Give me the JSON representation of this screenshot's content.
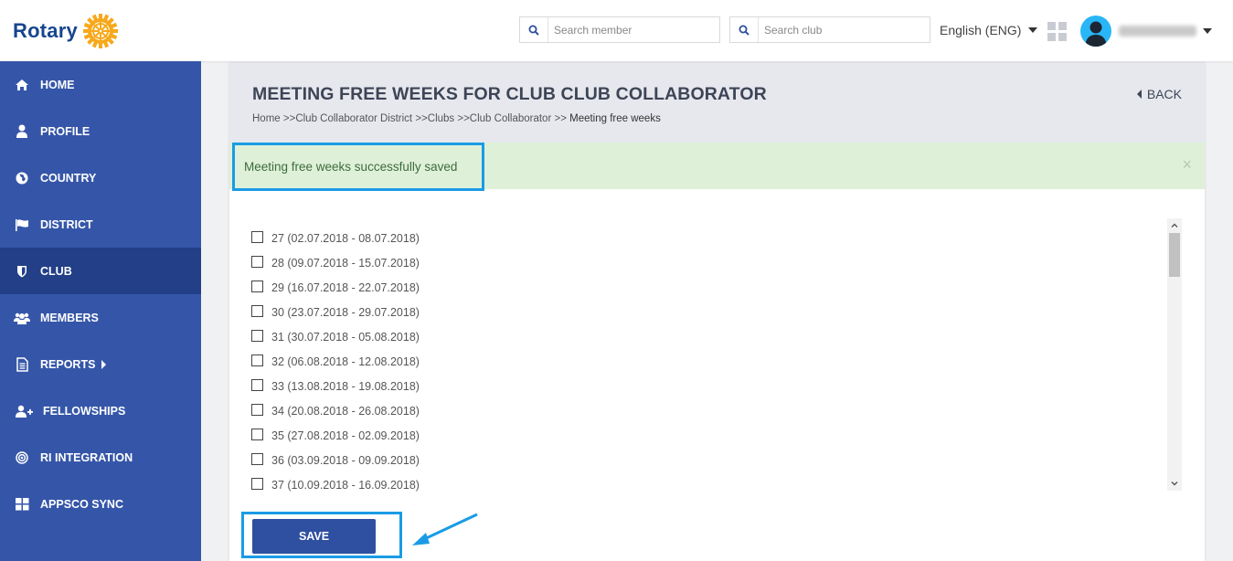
{
  "header": {
    "logo_text": "Rotary",
    "search_member_placeholder": "Search member",
    "search_club_placeholder": "Search club",
    "language": "English (ENG)"
  },
  "sidebar": {
    "items": [
      {
        "label": "HOME",
        "icon": "home-icon"
      },
      {
        "label": "PROFILE",
        "icon": "user-icon"
      },
      {
        "label": "COUNTRY",
        "icon": "globe-icon"
      },
      {
        "label": "DISTRICT",
        "icon": "flag-icon"
      },
      {
        "label": "CLUB",
        "icon": "shield-icon"
      },
      {
        "label": "MEMBERS",
        "icon": "users-icon"
      },
      {
        "label": "REPORTS",
        "icon": "document-icon"
      },
      {
        "label": "FELLOWSHIPS",
        "icon": "user-plus-icon"
      },
      {
        "label": "RI INTEGRATION",
        "icon": "target-icon"
      },
      {
        "label": "APPSCO SYNC",
        "icon": "grid-icon"
      }
    ],
    "active": "CLUB"
  },
  "page": {
    "title": "MEETING FREE WEEKS FOR CLUB CLUB COLLABORATOR",
    "back_label": "BACK",
    "breadcrumb": [
      {
        "label": "Home >>"
      },
      {
        "label": "Club Collaborator District >>"
      },
      {
        "label": "Clubs >>"
      },
      {
        "label": "Club Collaborator >>"
      },
      {
        "label": " Meeting free weeks"
      }
    ],
    "alert": "Meeting free weeks successfully saved",
    "alert_close": "×",
    "weeks": [
      "27 (02.07.2018 - 08.07.2018)",
      "28 (09.07.2018 - 15.07.2018)",
      "29 (16.07.2018 - 22.07.2018)",
      "30 (23.07.2018 - 29.07.2018)",
      "31 (30.07.2018 - 05.08.2018)",
      "32 (06.08.2018 - 12.08.2018)",
      "33 (13.08.2018 - 19.08.2018)",
      "34 (20.08.2018 - 26.08.2018)",
      "35 (27.08.2018 - 02.09.2018)",
      "36 (03.09.2018 - 09.09.2018)",
      "37 (10.09.2018 - 16.09.2018)"
    ],
    "save_label": "SAVE"
  },
  "colors": {
    "brand_blue": "#17458f",
    "sidebar": "#3556a8",
    "sidebar_active": "#223f88",
    "rotary_gold": "#f7a81b",
    "highlight": "#1a9be6",
    "alert_bg": "#dff0d8"
  }
}
